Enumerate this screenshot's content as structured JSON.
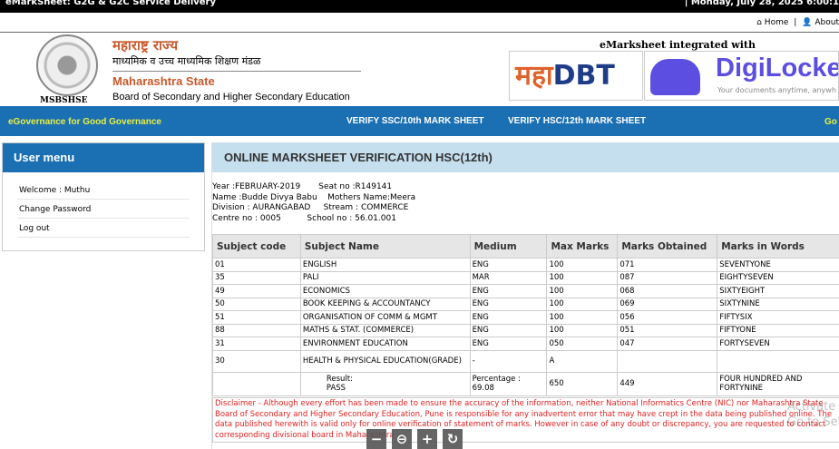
{
  "topbar": {
    "title": "eMarkSheet: G2G & G2C Service Delivery",
    "datetime": "| Monday, July 28, 2025 6:00:1"
  },
  "links": {
    "home": "Home",
    "sep": "|",
    "about": "About"
  },
  "header": {
    "seal_text": "MSBSHSE",
    "marathi_state": "महाराष्ट्र राज्य",
    "marathi_board": "माध्यमिक व उच्च माध्यमिक शिक्षण मंडळ",
    "state": "Maharashtra State",
    "board": "Board of Secondary and Higher Secondary Education",
    "integrated": "eMarksheet integrated with",
    "mahadbt_a": "महा",
    "mahadbt_b": "DBT",
    "digilocker": "DigiLocke",
    "digilocker_tag": "Your documents anytime, anywh"
  },
  "nav": {
    "tagline": "eGovernance for Good Governance",
    "verify_ssc": "VERIFY SSC/10th MARK SHEET",
    "verify_hsc": "VERIFY HSC/12th MARK SHEET",
    "go": "Go"
  },
  "sidebar": {
    "title": "User menu",
    "items": [
      {
        "label": "Welcome : Muthu"
      },
      {
        "label": "Change Password"
      },
      {
        "label": "Log out"
      }
    ]
  },
  "main": {
    "title": "ONLINE MARKSHEET VERIFICATION HSC(12th)",
    "info": "Year :FEBRUARY-2019       Seat no :R149141\nName :Budde Divya Babu    Mothers Name:Meera\nDivision : AURANGABAD     Stream : COMMERCE\nCentre no : 0005          School no : 56.01.001",
    "columns": [
      "Subject code",
      "Subject Name",
      "Medium",
      "Max Marks",
      "Marks Obtained",
      "Marks in Words"
    ],
    "rows": [
      [
        "01",
        "ENGLISH",
        "ENG",
        "100",
        "071",
        "SEVENTYONE"
      ],
      [
        "35",
        "PALI",
        "MAR",
        "100",
        "087",
        "EIGHTYSEVEN"
      ],
      [
        "49",
        "ECONOMICS",
        "ENG",
        "100",
        "068",
        "SIXTYEIGHT"
      ],
      [
        "50",
        "BOOK KEEPING & ACCOUNTANCY",
        "ENG",
        "100",
        "069",
        "SIXTYNINE"
      ],
      [
        "51",
        "ORGANISATION OF COMM & MGMT",
        "ENG",
        "100",
        "056",
        "FIFTYSIX"
      ],
      [
        "88",
        "MATHS & STAT. (COMMERCE)",
        "ENG",
        "100",
        "051",
        "FIFTYONE"
      ],
      [
        "31",
        "ENVIRONMENT EDUCATION",
        "ENG",
        "050",
        "047",
        "FORTYSEVEN"
      ],
      [
        "30",
        "HEALTH & PHYSICAL EDUCATION(GRADE)",
        "-",
        "A",
        "",
        ""
      ]
    ],
    "result_label": "Result:",
    "result": "PASS",
    "percentage_label": "Percentage :",
    "percentage": "69.08",
    "total_max": "650",
    "total_obtained": "449",
    "total_words": "FOUR HUNDRED AND FORTYNINE",
    "disclaimer": "Disclaimer - Although every effort has been made to ensure the accuracy of the information, neither National Informatics Centre (NIC) nor Maharashtra State Board of Secondary and Higher Secondary Education, Pune is responsible for any inadvertent error that may have crept in the data being published online. The data published herewith is valid only for online verification of statement of marks. However in case of any doubt or discrepancy, you are requested to contact corresponding divisional board in Maharashtra"
  },
  "viewer": {
    "zoom_out": "−",
    "zoom_fit": "⊖",
    "zoom_in": "+",
    "rotate": "↻"
  },
  "watermark": {
    "line1": "Activate",
    "line2": "Go to Setti"
  }
}
